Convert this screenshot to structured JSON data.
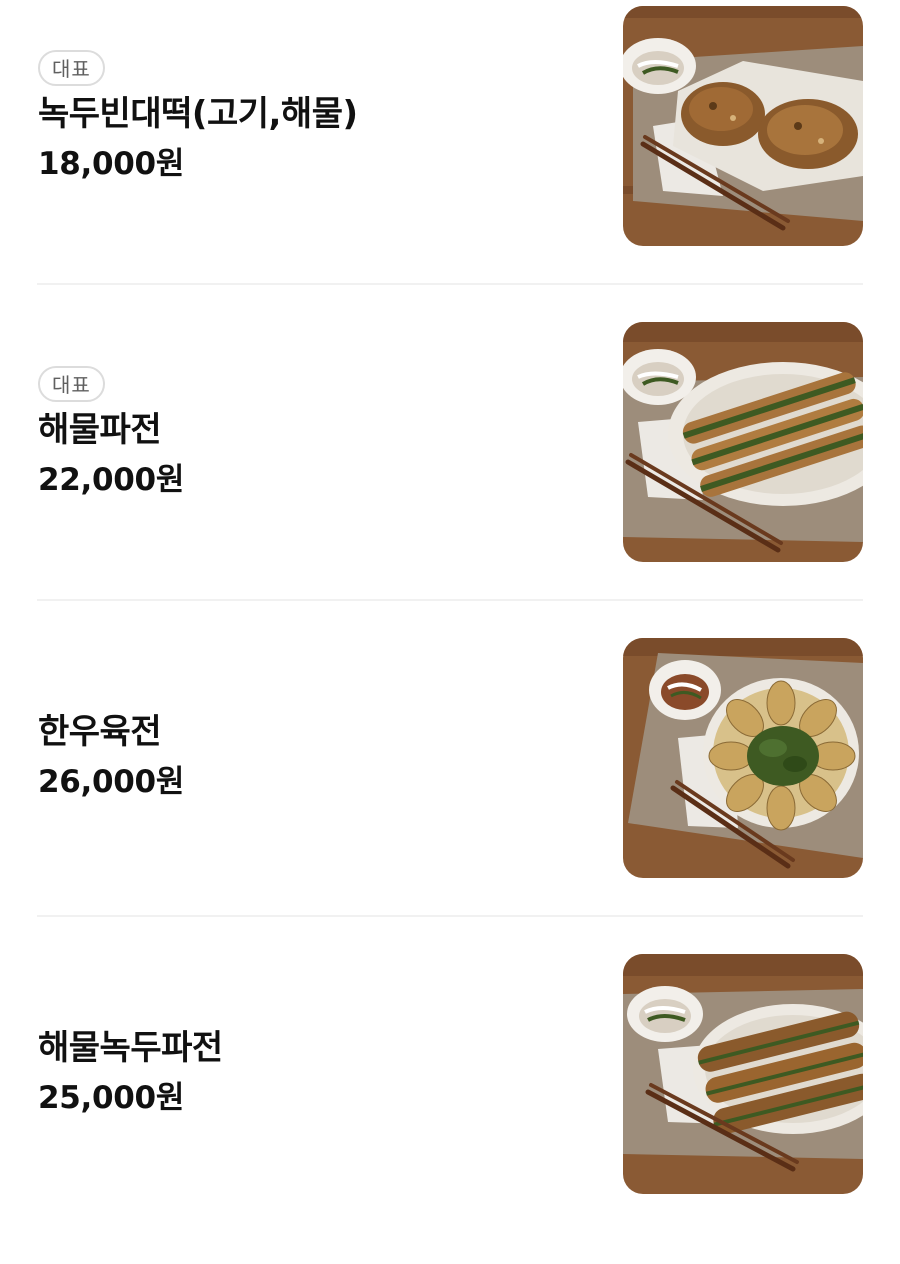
{
  "menu": {
    "items": [
      {
        "badge": "대표",
        "name": "녹두빈대떡(고기,해물)",
        "price": "18,000원",
        "image": "mungbean-pancake-photo"
      },
      {
        "badge": "대표",
        "name": "해물파전",
        "price": "22,000원",
        "image": "seafood-scallion-pancake-photo"
      },
      {
        "name": "한우육전",
        "price": "26,000원",
        "image": "beef-jeon-photo"
      },
      {
        "name": "해물녹두파전",
        "price": "25,000원",
        "image": "seafood-mungbean-pancake-photo"
      }
    ]
  },
  "colors": {
    "wood": "#8a5a34",
    "placemat": "#9d8d7b",
    "pancake": "#8a5a2c",
    "scallion": "#3e5a22"
  }
}
